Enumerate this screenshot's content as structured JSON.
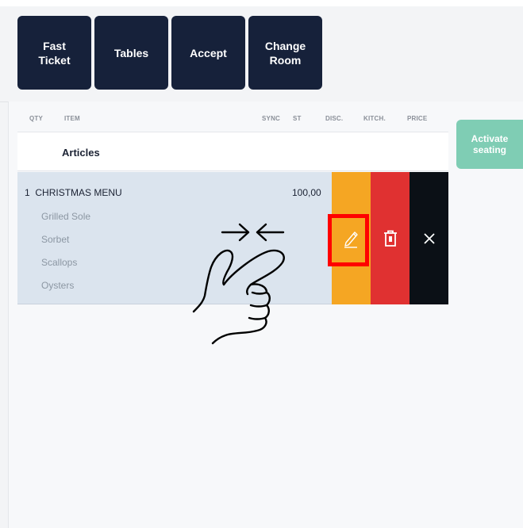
{
  "toolbar": {
    "buttons": [
      {
        "label": "Fast\nTicket"
      },
      {
        "label": "Tables"
      },
      {
        "label": "Accept"
      },
      {
        "label": "Change\nRoom"
      }
    ]
  },
  "columns": {
    "qty": "QTY",
    "item": "ITEM",
    "sync": "SYNC",
    "st": "ST",
    "disc": "DISC.",
    "kitch": "KITCH.",
    "price": "PRICE"
  },
  "section": {
    "title": "Articles"
  },
  "order_item": {
    "qty": "1",
    "name": "CHRISTMAS MENU",
    "price": "100,00",
    "sub_items": [
      "Grilled Sole",
      "Sorbet",
      "Scallops",
      "Oysters"
    ]
  },
  "side": {
    "activate_label": "Activate\nseating"
  },
  "colors": {
    "toolbar_button": "#16213a",
    "edit_action": "#f5a623",
    "delete_action": "#e03131",
    "close_action": "#0b1016",
    "activate": "#7fcdb4",
    "highlight": "#ff0000"
  },
  "icons": {
    "edit": "pencil-icon",
    "delete": "trash-icon",
    "close": "close-icon",
    "gesture": "pinch-hand-icon"
  }
}
